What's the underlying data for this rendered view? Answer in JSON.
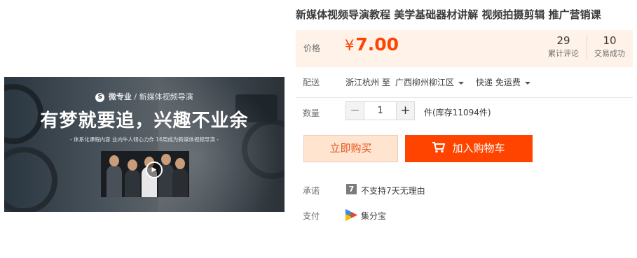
{
  "banner": {
    "brand_logo": "S",
    "brand_name": "微专业",
    "brand_course": " / 新媒体视频导演",
    "headline": "有梦就要追，兴趣不业余",
    "subline": "- 体系化课程内容 业内牛人倾心力作 16周成为新媒体视频导演 -"
  },
  "product": {
    "title": "新媒体视频导演教程 美学基础器材讲解 视频拍摄剪辑 推广营销课"
  },
  "price": {
    "label": "价格",
    "currency": "¥",
    "value": "7.00",
    "reviews_count": "29",
    "reviews_label": "累计评论",
    "sales_count": "10",
    "sales_label": "交易成功"
  },
  "shipping": {
    "label": "配送",
    "from": "浙江杭州 至",
    "to": "广西柳州柳江区",
    "method": "快递 免运费"
  },
  "quantity": {
    "label": "数量",
    "minus": "−",
    "value": "1",
    "plus": "+",
    "stock": "件(库存11094件)"
  },
  "actions": {
    "buy_now": "立即购买",
    "add_to_cart": "加入购物车"
  },
  "promise": {
    "label": "承诺",
    "icon_glyph": "7",
    "text": "不支持7天无理由"
  },
  "payment": {
    "label": "支付",
    "text": "集分宝"
  },
  "colors": {
    "accent": "#ff4400",
    "price_bg": "#fff2e8",
    "buy_bg": "#ffe4d0"
  }
}
